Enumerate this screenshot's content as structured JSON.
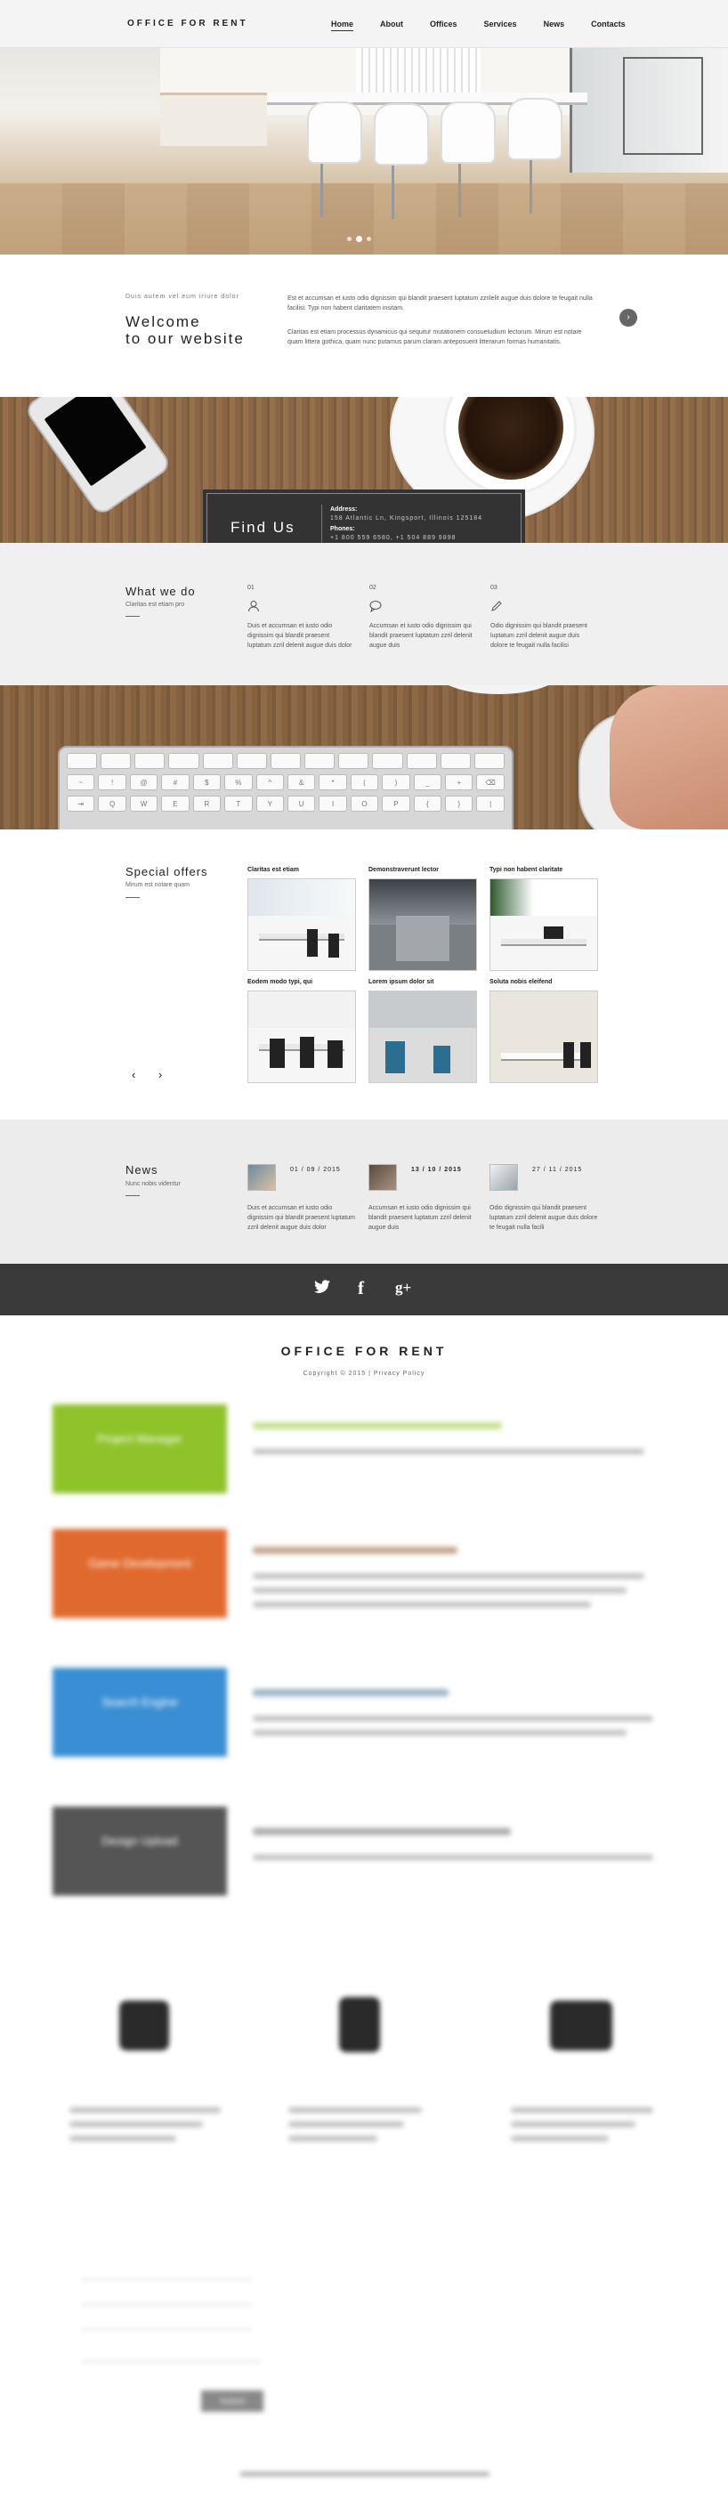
{
  "header": {
    "logo": "OFFICE FOR RENT",
    "nav": [
      "Home",
      "About",
      "Offices",
      "Services",
      "News",
      "Contacts"
    ]
  },
  "hero": {
    "slides": 3,
    "active_slide": 2
  },
  "welcome": {
    "small": "Duis autem vel eum iriure dolor",
    "title_line1": "Welcome",
    "title_line2": "to our website",
    "p1": "Est et accumsan et iusto odio dignissim qui blandit praesent luptatum zzrilelit augue duis dolore te feugait nulla facilisi. Typi non habent claritatem insitam.",
    "p2": "Claritas est etiam processus dynamicus qui sequitur mutationem consuetudium lectorum. Mirum est notare quam littera gothica, quam nunc putamus parum claram anteposuerit litterarum formas humanitatis.",
    "more_icon": "arrow-right-icon"
  },
  "findus": {
    "title": "Find Us",
    "address_label": "Address:",
    "address": "158 Atlantic Ln, Kingsport, Illinois 125184",
    "phones_label": "Phones:",
    "phones": "+1 800 559 6580, +1 504 889 9898"
  },
  "whatwedo": {
    "title": "What we do",
    "subtitle": "Claritas est etiam pro",
    "items": [
      {
        "num": "01",
        "icon": "user-icon",
        "text": "Duis et accumsan et iusto odio dignissim qui blandit praesent luptatum zzril delenit augue duis dolor"
      },
      {
        "num": "02",
        "icon": "chat-icon",
        "text": "Accumsan et iusto odio dignissim qui blandit praesent luptatum zzril delenit augue duis"
      },
      {
        "num": "03",
        "icon": "pencil-icon",
        "text": "Odio dignissim qui blandit praesent luptatum zzril delenit augue duis dolore te feugait nulla facilisi"
      }
    ]
  },
  "offers": {
    "title": "Special offers",
    "subtitle": "Mirum est notare quam",
    "prev": "‹",
    "next": "›",
    "items": [
      "Claritas est etiam",
      "Demonstraverunt lector",
      "Typi non habent claritate",
      "Eodem modo typi, qui",
      "Lorem ipsum dolor sit",
      "Soluta nobis eleifend"
    ]
  },
  "news": {
    "title": "News",
    "subtitle": "Nunc nobis videntur",
    "items": [
      {
        "date": "01 / 09 / 2015",
        "text": "Duis et accumsan et iusto odio dignissim qui blandit praesent luptatum zzril delenit augue duis dolor"
      },
      {
        "date": "13 / 10 / 2015",
        "text": "Accumsan et iusto odio dignissim qui blandit praesent luptatum zzril delenit augue duis"
      },
      {
        "date": "27 / 11 / 2015",
        "text": "Odio dignissim qui blandit praesent luptatum zzril delenit augue duis dolore te feugait nulla facili"
      }
    ]
  },
  "social": {
    "twitter": "t",
    "facebook": "f",
    "gplus": "g+"
  },
  "footer": {
    "logo": "OFFICE FOR RENT",
    "copyright": "Copyright © 2015 | Privacy Policy"
  },
  "blurred": {
    "tiles": [
      "Project Manager",
      "Game Development",
      "Search Engine",
      "Design Upload"
    ],
    "tile_colors": [
      "#8fc32a",
      "#e06a2e",
      "#3a8fd4",
      "#555555"
    ],
    "button": "Submit"
  }
}
